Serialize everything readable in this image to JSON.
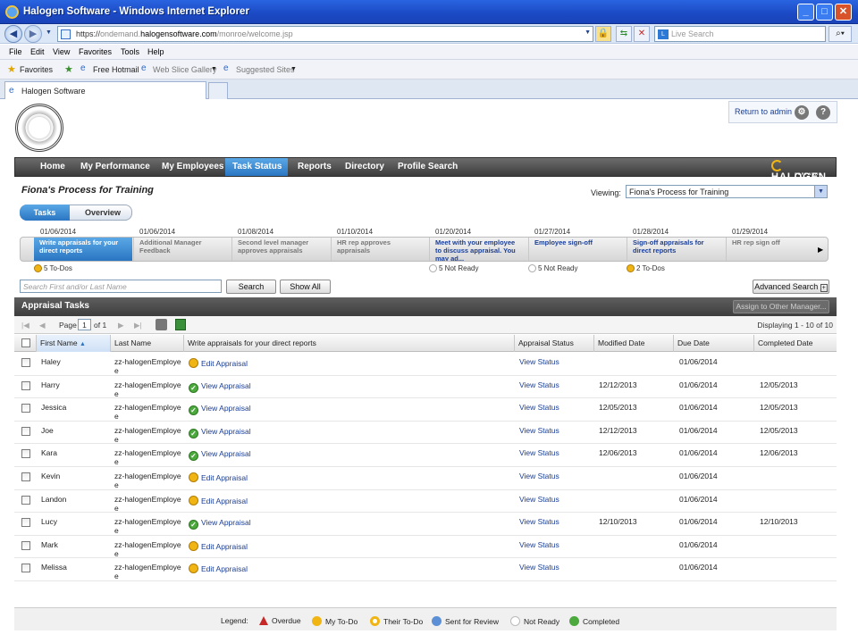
{
  "browser": {
    "title": "Halogen Software - Windows Internet Explorer",
    "url_scheme": "https://",
    "url_sub": "ondemand.",
    "url_host": "halogensoftware.com",
    "url_path": "/monroe/welcome.jsp",
    "search_placeholder": "Live Search",
    "search_brand": "L",
    "menu": [
      "File",
      "Edit",
      "View",
      "Favorites",
      "Tools",
      "Help"
    ],
    "favorites_label": "Favorites",
    "fav_links": [
      "Free Hotmail",
      "Web Slice Gallery",
      "Suggested Sites"
    ],
    "tab_title": "Halogen Software"
  },
  "header": {
    "return_admin": "Return to admin"
  },
  "nav": {
    "items": [
      "Home",
      "My Performance",
      "My Employees",
      "Task Status",
      "Reports",
      "Directory",
      "Profile Search"
    ],
    "active": "Task Status",
    "logo": "HALOGEN",
    "logo_sub": "SOFTWARE"
  },
  "process": {
    "title": "Fiona's Process for Training",
    "viewing_label": "Viewing:",
    "viewing_value": "Fiona's Process for Training",
    "tabs": [
      "Tasks",
      "Overview"
    ]
  },
  "timeline": [
    {
      "date": "01/06/2014",
      "label": "Write appraisals for your direct reports",
      "status": "5 To-Dos"
    },
    {
      "date": "01/06/2014",
      "label": "Additional Manager Feedback",
      "status": ""
    },
    {
      "date": "01/08/2014",
      "label": "Second level manager approves appraisals",
      "status": ""
    },
    {
      "date": "01/10/2014",
      "label": "HR rep approves appraisals",
      "status": ""
    },
    {
      "date": "01/20/2014",
      "label": "Meet with your employee to discuss appraisal. You may ad...",
      "status": "5 Not Ready"
    },
    {
      "date": "01/27/2014",
      "label": "Employee sign-off",
      "status": "5 Not Ready"
    },
    {
      "date": "01/28/2014",
      "label": "Sign-off appraisals for direct reports",
      "status": "2 To-Dos"
    },
    {
      "date": "01/29/2014",
      "label": "HR rep sign off",
      "status": ""
    }
  ],
  "search": {
    "placeholder": "Search First and/or Last Name",
    "search_btn": "Search",
    "show_all_btn": "Show All",
    "advanced_btn": "Advanced Search"
  },
  "grid": {
    "title": "Appraisal Tasks",
    "assign_btn": "Assign to Other Manager...",
    "page_label": "Page",
    "page_value": "1",
    "page_of": "of 1",
    "displaying": "Displaying 1 - 10 of 10",
    "columns": [
      "First Name",
      "Last Name",
      "Write appraisals for your direct reports",
      "Appraisal Status",
      "Modified Date",
      "Due Date",
      "Completed Date"
    ],
    "rows": [
      {
        "first": "Haley",
        "last1": "zz-halogenEmploye",
        "last2": "e",
        "action": "Edit Appraisal",
        "kind": "todo",
        "status": "View Status",
        "modified": "",
        "due": "01/06/2014",
        "completed": ""
      },
      {
        "first": "Harry",
        "last1": "zz-halogenEmploye",
        "last2": "e",
        "action": "View Appraisal",
        "kind": "done",
        "status": "View Status",
        "modified": "12/12/2013",
        "due": "01/06/2014",
        "completed": "12/05/2013"
      },
      {
        "first": "Jessica",
        "last1": "zz-halogenEmploye",
        "last2": "e",
        "action": "View Appraisal",
        "kind": "done",
        "status": "View Status",
        "modified": "12/05/2013",
        "due": "01/06/2014",
        "completed": "12/05/2013"
      },
      {
        "first": "Joe",
        "last1": "zz-halogenEmploye",
        "last2": "e",
        "action": "View Appraisal",
        "kind": "done",
        "status": "View Status",
        "modified": "12/12/2013",
        "due": "01/06/2014",
        "completed": "12/05/2013"
      },
      {
        "first": "Kara",
        "last1": "zz-halogenEmploye",
        "last2": "e",
        "action": "View Appraisal",
        "kind": "done",
        "status": "View Status",
        "modified": "12/06/2013",
        "due": "01/06/2014",
        "completed": "12/06/2013"
      },
      {
        "first": "Kevin",
        "last1": "zz-halogenEmploye",
        "last2": "e",
        "action": "Edit Appraisal",
        "kind": "todo",
        "status": "View Status",
        "modified": "",
        "due": "01/06/2014",
        "completed": ""
      },
      {
        "first": "Landon",
        "last1": "zz-halogenEmploye",
        "last2": "e",
        "action": "Edit Appraisal",
        "kind": "todo",
        "status": "View Status",
        "modified": "",
        "due": "01/06/2014",
        "completed": ""
      },
      {
        "first": "Lucy",
        "last1": "zz-halogenEmploye",
        "last2": "e",
        "action": "View Appraisal",
        "kind": "done",
        "status": "View Status",
        "modified": "12/10/2013",
        "due": "01/06/2014",
        "completed": "12/10/2013"
      },
      {
        "first": "Mark",
        "last1": "zz-halogenEmploye",
        "last2": "e",
        "action": "Edit Appraisal",
        "kind": "todo",
        "status": "View Status",
        "modified": "",
        "due": "01/06/2014",
        "completed": ""
      },
      {
        "first": "Melissa",
        "last1": "zz-halogenEmploye",
        "last2": "e",
        "action": "Edit Appraisal",
        "kind": "todo",
        "status": "View Status",
        "modified": "",
        "due": "01/06/2014",
        "completed": ""
      }
    ]
  },
  "legend": {
    "label": "Legend:",
    "items": [
      {
        "text": "Overdue",
        "icon": "overdue-icon",
        "color": "#c62828"
      },
      {
        "text": "My To-Do",
        "icon": "my-todo-icon",
        "color": "#f0b515"
      },
      {
        "text": "Their To-Do",
        "icon": "their-todo-icon",
        "color": "#f0b515"
      },
      {
        "text": "Sent for Review",
        "icon": "sent-review-icon",
        "color": "#5b8fd6"
      },
      {
        "text": "Not Ready",
        "icon": "not-ready-icon",
        "color": "#bbbbbb"
      },
      {
        "text": "Completed",
        "icon": "completed-icon",
        "color": "#4ca93d"
      }
    ]
  }
}
